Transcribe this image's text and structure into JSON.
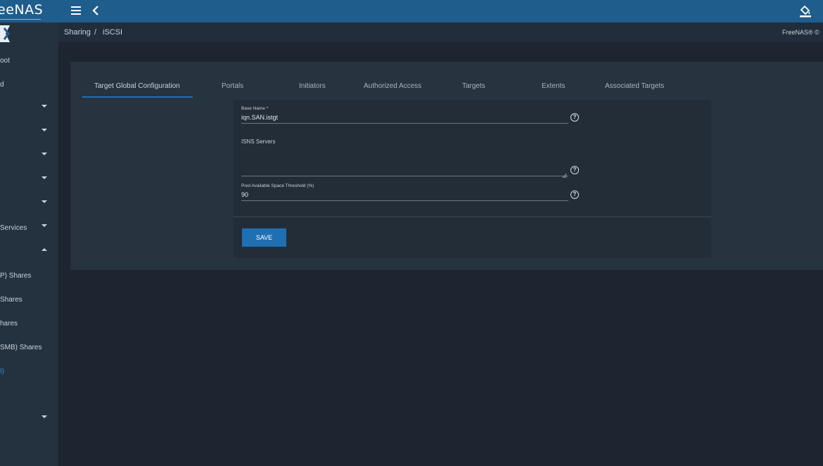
{
  "app": {
    "logo_text": "eeNAS",
    "version": "FreeNAS® ©"
  },
  "breadcrumb": {
    "parent": "Sharing",
    "separator": "/",
    "current": "iSCSI"
  },
  "sidebar": {
    "items": [
      {
        "label": "oot",
        "caret": "none"
      },
      {
        "label": "d",
        "caret": "none"
      },
      {
        "label": "",
        "caret": "down"
      },
      {
        "label": "",
        "caret": "down"
      },
      {
        "label": "",
        "caret": "down"
      },
      {
        "label": "",
        "caret": "down"
      },
      {
        "label": "",
        "caret": "down"
      },
      {
        "label": "Services",
        "caret": "down"
      },
      {
        "label": "",
        "caret": "up"
      },
      {
        "label": "P) Shares",
        "caret": "none"
      },
      {
        "label": "Shares",
        "caret": "none"
      },
      {
        "label": "hares",
        "caret": "none"
      },
      {
        "label": "SMB) Shares",
        "caret": "none"
      },
      {
        "label": "I)",
        "caret": "none",
        "active": true
      },
      {
        "label": "",
        "caret": "down"
      }
    ]
  },
  "tabs": [
    {
      "label": "Target Global Configuration",
      "active": true
    },
    {
      "label": "Portals"
    },
    {
      "label": "Initiators"
    },
    {
      "label": "Authorized Access"
    },
    {
      "label": "Targets"
    },
    {
      "label": "Extents"
    },
    {
      "label": "Associated Targets"
    }
  ],
  "form": {
    "base_name": {
      "label": "Base Name *",
      "value": "iqn.SAN.istgt"
    },
    "isns_servers": {
      "label": "ISNS Servers",
      "value": ""
    },
    "pool_threshold": {
      "label": "Pool Available Space Threshold (%)",
      "value": "90"
    },
    "help_glyph": "?",
    "save_label": "SAVE"
  },
  "colors": {
    "topbar": "#1f5d8c",
    "accent": "#1f6fb3",
    "sidebar": "#243240",
    "card": "#27333f",
    "background": "#1c2530"
  },
  "icons": {
    "menu": "hamburger-icon",
    "back": "chevron-left-icon",
    "theme": "paint-bucket-icon",
    "help": "help-circle-icon"
  }
}
